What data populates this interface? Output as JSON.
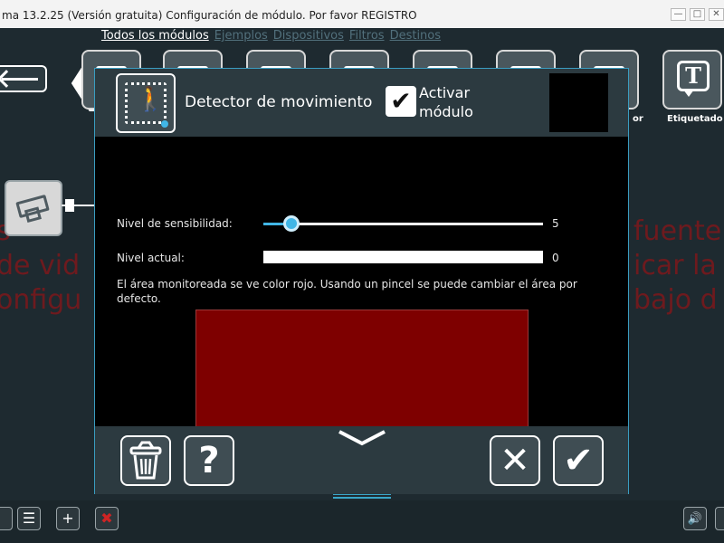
{
  "window": {
    "title": "ma 13.2.25 (Versión gratuita) Configuración de módulo. Por favor REGISTRO",
    "minimize_glyph": "—",
    "maximize_glyph": "□",
    "close_glyph": "✕"
  },
  "menu": {
    "items": [
      {
        "label": "Todos los módulos",
        "active": true
      },
      {
        "label": "Ejemplos"
      },
      {
        "label": "Dispositivos"
      },
      {
        "label": "Filtros"
      },
      {
        "label": "Destinos"
      }
    ]
  },
  "toolbar": {
    "partial_label": "or",
    "labeled_label": "Etiquetado",
    "text_icon_glyph": "T"
  },
  "background_text": {
    "line1_left": "s",
    "line2_left": "de vid",
    "line3_left": "onfigu",
    "line1_right": "fuente",
    "line2_right": "icar la",
    "line3_right": "bajo d"
  },
  "dialog": {
    "module_title": "Detector de movimiento",
    "enable_label": "Activar módulo",
    "enable_checked": true,
    "check_glyph": "✔",
    "sensitivity_label": "Nivel de sensibilidad:",
    "sensitivity_value": "5",
    "sensitivity_fraction": 0.1,
    "current_level_label": "Nivel actual:",
    "current_level_value": "0",
    "help_text": "El área monitoreada se ve color rojo. Usando un pincel se puede cambiar el área por defecto.",
    "colors": {
      "monitored_area": "#7e0000",
      "accent": "#41b6e6"
    },
    "footer": {
      "help_glyph": "?",
      "cancel_glyph": "✕",
      "ok_glyph": "✔"
    }
  },
  "bottom_bar": {
    "list_glyph": "☰",
    "add_glyph": "+",
    "delete_glyph": "✖",
    "sound_glyph": "🔊"
  }
}
